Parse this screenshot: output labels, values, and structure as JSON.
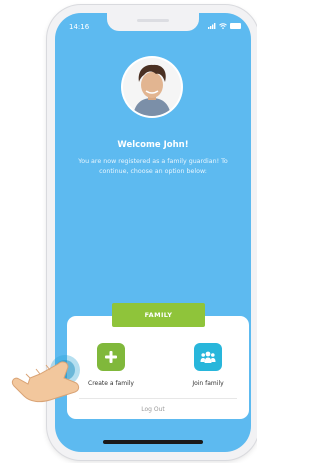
{
  "status_bar": {
    "time": "14:16"
  },
  "welcome": {
    "title": "Welcome John!",
    "message": "You are now registered as a family guardian! To continue, choose an option below:"
  },
  "family_card": {
    "tag_label": "FAMILY",
    "options": [
      {
        "label": "Create a family",
        "icon": "plus-icon",
        "color": "#80b83b"
      },
      {
        "label": "Join family",
        "icon": "group-icon",
        "color": "#28b6db"
      }
    ],
    "logout_label": "Log Out"
  },
  "colors": {
    "screen_background": "#5dbaf0",
    "accent_green": "#8fc43a",
    "accent_blue": "#28b6db"
  }
}
